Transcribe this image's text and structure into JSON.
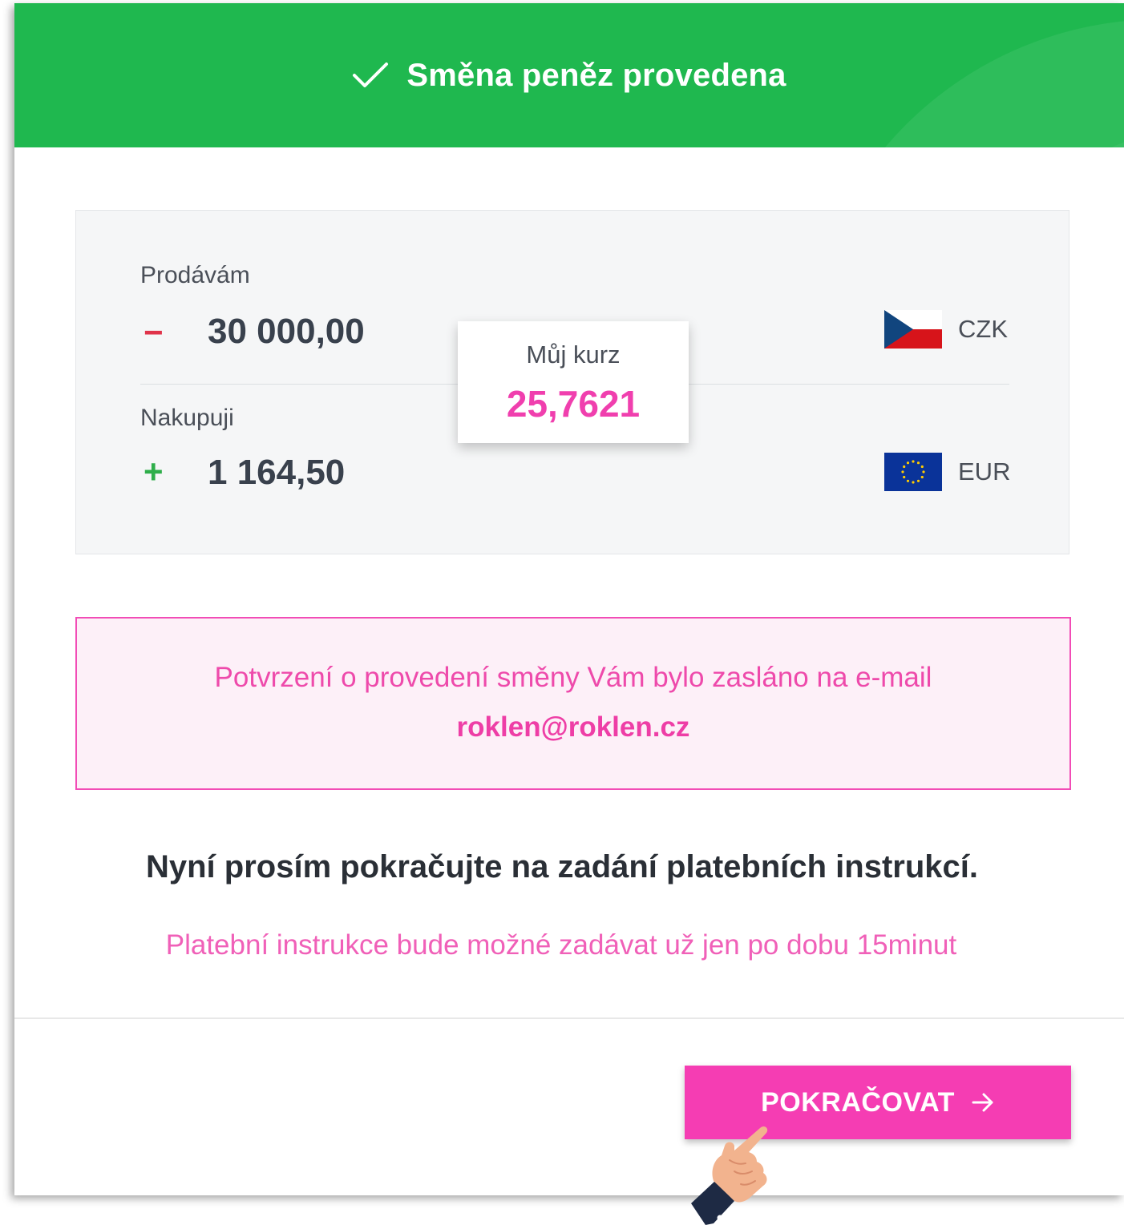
{
  "header": {
    "title": "Směna peněz provedena",
    "icon": "check-icon",
    "color": "#1fb84f"
  },
  "exchange": {
    "sell": {
      "label": "Prodávám",
      "sign": "−",
      "amount": "30 000,00",
      "currency": "CZK",
      "flag_icon": "czech-flag-icon"
    },
    "buy": {
      "label": "Nakupuji",
      "sign": "+",
      "amount": "1 164,50",
      "currency": "EUR",
      "flag_icon": "eu-flag-icon"
    },
    "rate": {
      "label": "Můj kurz",
      "value": "25,7621"
    }
  },
  "notice": {
    "text": "Potvrzení o provedení směny Vám bylo zasláno na e-mail",
    "email": "roklen@roklen.cz"
  },
  "instruction": "Nyní prosím pokračujte na zadání platebních instrukcí.",
  "timer_note": "Platební instrukce bude možné zadávat už jen po dobu 15minut",
  "continue_button": {
    "label": "POKRAČOVAT",
    "icon": "arrow-right-icon",
    "color": "#f53db3"
  },
  "accent_color": "#ee3ea6"
}
